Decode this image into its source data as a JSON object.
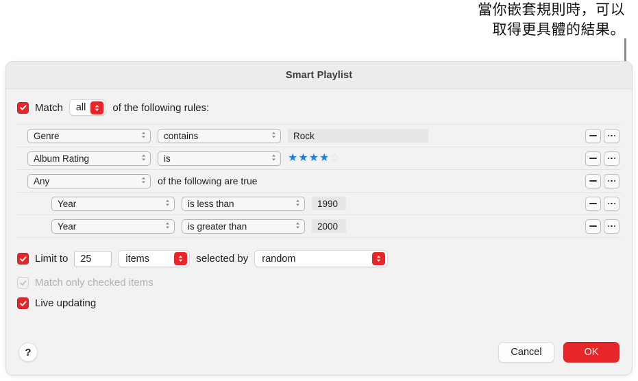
{
  "callout": {
    "text": "當你嵌套規則時，可以\n取得更具體的結果。"
  },
  "dialog": {
    "title": "Smart Playlist"
  },
  "match": {
    "checkbox_label": "Match",
    "scope_value": "all",
    "suffix_text": "of the following rules:",
    "checked": true
  },
  "rules": [
    {
      "indent": 0,
      "field": "Genre",
      "operator": "contains",
      "value": "Rock",
      "value_kind": "text-wide"
    },
    {
      "indent": 0,
      "field": "Album Rating",
      "operator": "is",
      "value_kind": "stars",
      "stars_filled": 4,
      "stars_total": 5
    },
    {
      "indent": 0,
      "field": "Any",
      "value_kind": "group",
      "group_text": "of the following are true"
    },
    {
      "indent": 1,
      "field": "Year",
      "operator": "is less than",
      "value": "1990",
      "value_kind": "text-narrow"
    },
    {
      "indent": 1,
      "field": "Year",
      "operator": "is greater than",
      "value": "2000",
      "value_kind": "text-narrow"
    }
  ],
  "row_buttons": {
    "remove_label": "remove-rule",
    "more_label": "more-options"
  },
  "limit": {
    "checked": true,
    "label": "Limit to",
    "count": "25",
    "unit": "items",
    "middle_text": "selected by",
    "order": "random"
  },
  "match_checked_items": {
    "label": "Match only checked items",
    "checked": true,
    "disabled": true
  },
  "live_updating": {
    "label": "Live updating",
    "checked": true
  },
  "footer": {
    "help_label": "?",
    "cancel_label": "Cancel",
    "ok_label": "OK"
  },
  "colors": {
    "accent_red": "#e8262a",
    "star_blue": "#1b7fe8",
    "star_empty": "#cfe0f3",
    "dialog_bg": "#f2f2f2",
    "callout_gray": "#8a8a8a"
  }
}
